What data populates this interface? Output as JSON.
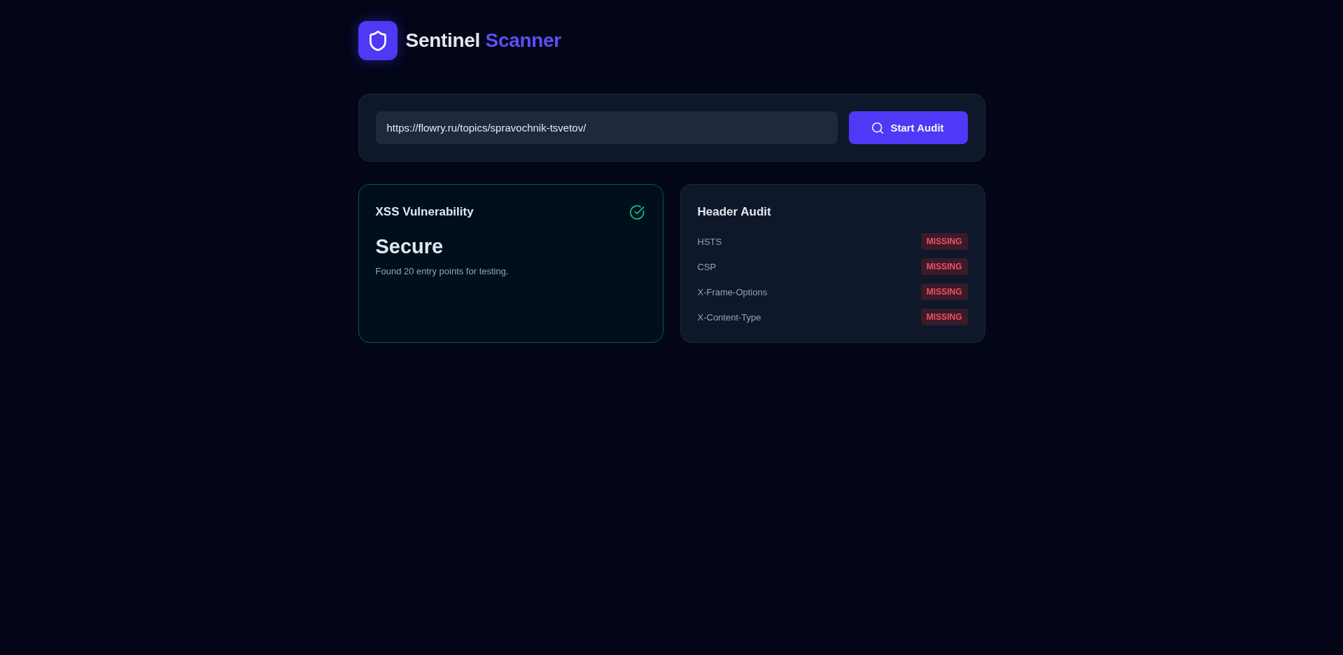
{
  "header": {
    "title": "Sentinel",
    "title_accent": "Scanner"
  },
  "scan_form": {
    "url": "https://flowry.ru/topics/spravochnik-tsvetov/",
    "button": "Start Audit"
  },
  "xss_card": {
    "title": "XSS Vulnerability",
    "secure": true,
    "verdict": "Secure",
    "detail": "Found 20 entry points for testing."
  },
  "header_audit": {
    "title": "Header Audit",
    "rows": [
      {
        "name": "HSTS",
        "missing": true,
        "badge": "MISSING"
      },
      {
        "name": "CSP",
        "missing": true,
        "badge": "MISSING"
      },
      {
        "name": "X-Frame-Options",
        "missing": true,
        "badge": "MISSING"
      },
      {
        "name": "X-Content-Type",
        "missing": true,
        "badge": "MISSING"
      }
    ]
  }
}
